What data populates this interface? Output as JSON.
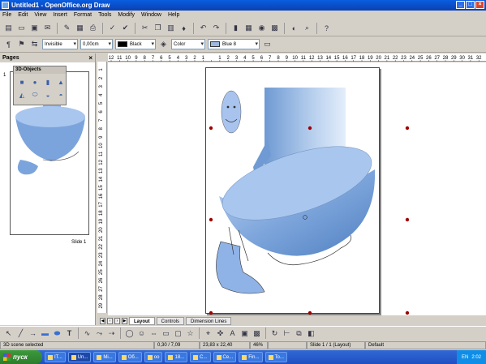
{
  "window": {
    "title": "Untitled1 - OpenOffice.org Draw",
    "min": "_",
    "max": "□",
    "close": "×"
  },
  "menu": [
    "File",
    "Edit",
    "View",
    "Insert",
    "Format",
    "Tools",
    "Modify",
    "Window",
    "Help"
  ],
  "toolbar2": {
    "line_style": "Invisible",
    "line_width": "0,00cm",
    "line_color": "Black",
    "fill_type": "Color",
    "fill_color": "Blue 8"
  },
  "colors": {
    "line_swatch": "#000000",
    "fill_swatch": "#9cb8e0",
    "shape_fill": "#8fb3e6",
    "shape_dark": "#4f7fc0"
  },
  "pages_panel": {
    "title": "Pages",
    "close": "×",
    "page_number": "1",
    "slide_label": "Slide 1"
  },
  "objects_panel": {
    "title": "3D-Objects",
    "items": [
      "cube-icon",
      "sphere-icon",
      "cylinder-icon",
      "cone-icon",
      "pyramid-icon",
      "torus-icon",
      "shell-icon",
      "half-sphere-icon"
    ]
  },
  "hruler_labels": [
    "12",
    "11",
    "10",
    "9",
    "8",
    "7",
    "6",
    "5",
    "4",
    "3",
    "2",
    "1",
    "",
    "1",
    "2",
    "3",
    "4",
    "5",
    "6",
    "7",
    "8",
    "9",
    "10",
    "11",
    "12",
    "13",
    "14",
    "15",
    "16",
    "17",
    "18",
    "19",
    "20",
    "21",
    "22",
    "23",
    "24",
    "25",
    "26",
    "27",
    "28",
    "29",
    "30",
    "31",
    "32"
  ],
  "vruler_labels": [
    "1",
    "2",
    "3",
    "4",
    "5",
    "6",
    "7",
    "8",
    "9",
    "10",
    "11",
    "12",
    "13",
    "14",
    "15",
    "16",
    "17",
    "18",
    "19",
    "20",
    "21",
    "22",
    "23",
    "24",
    "25",
    "26",
    "27",
    "28",
    "29"
  ],
  "tabs": [
    "Layout",
    "Controls",
    "Dimension Lines"
  ],
  "status": {
    "mode": "3D scene selected",
    "position": "0,30 / 7,09",
    "size": "23,83 x 22,40",
    "zoom": "46%",
    "slide": "Slide 1 / 1 (Layout)",
    "layout": "Default"
  },
  "taskbar": {
    "start": "пуск",
    "tasks": [
      "IT...",
      "Un...",
      "Mi...",
      "Об...",
      "oo",
      "18...",
      "C...",
      "Се...",
      "Fin...",
      "To..."
    ],
    "lang": "EN",
    "clock": "2:02"
  }
}
